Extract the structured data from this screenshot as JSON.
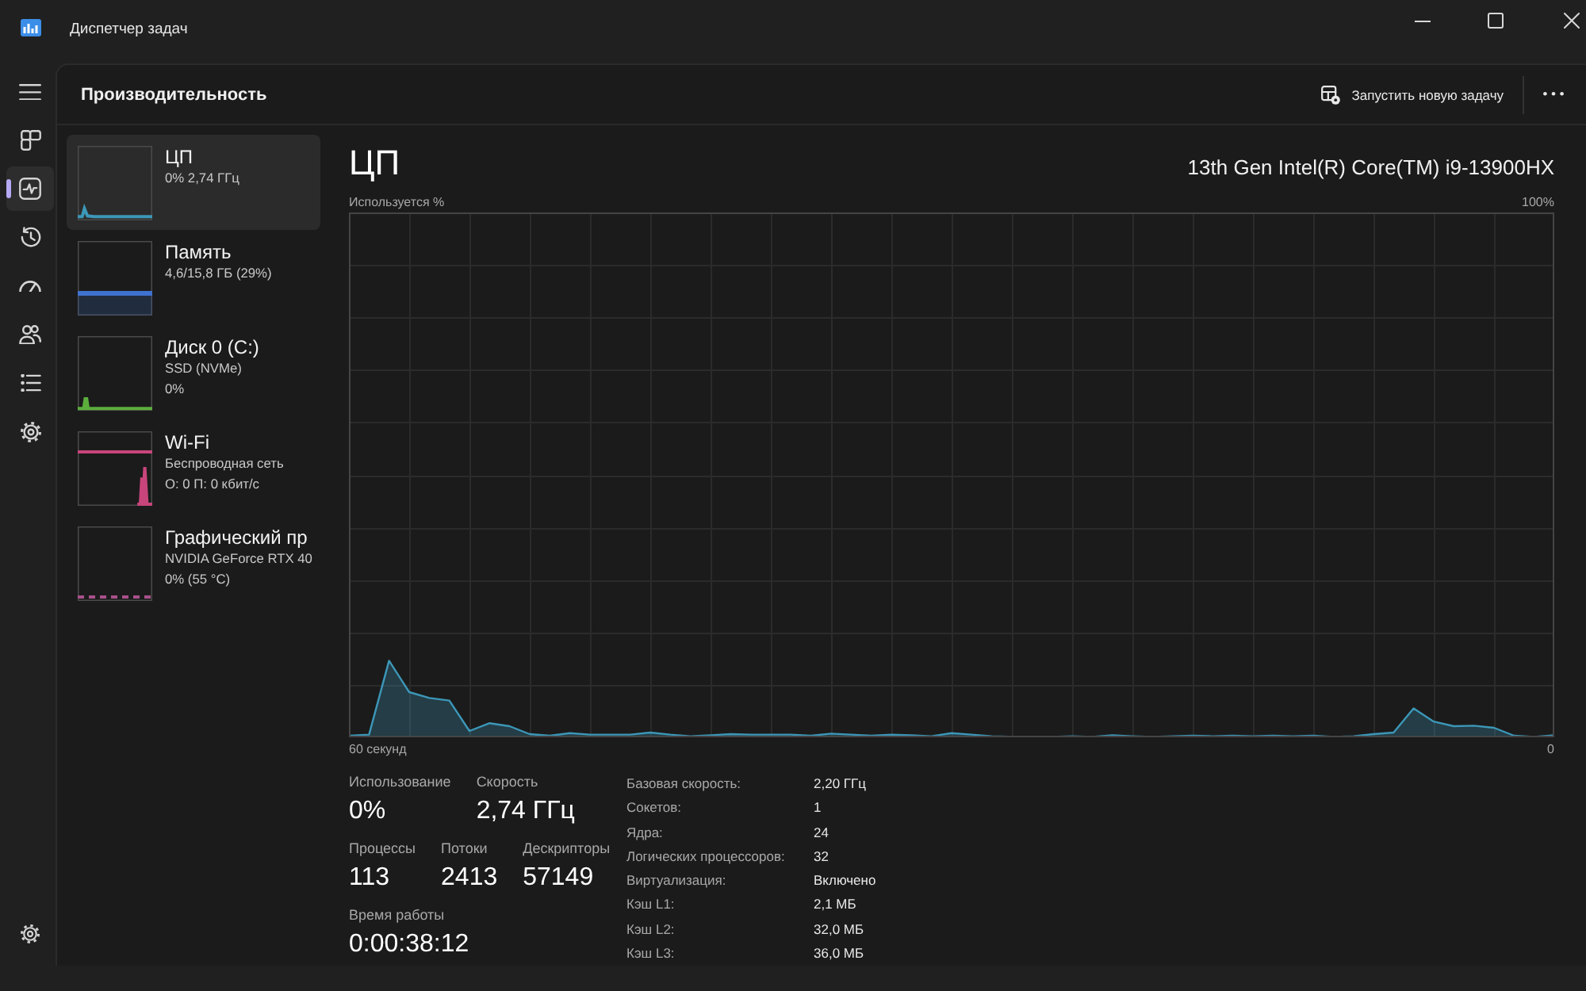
{
  "window": {
    "title": "Диспетчер задач"
  },
  "nav": {
    "items": [
      {
        "kind": "processes",
        "selected": false
      },
      {
        "kind": "performance",
        "selected": true
      },
      {
        "kind": "app_history",
        "selected": false
      },
      {
        "kind": "startup",
        "selected": false
      },
      {
        "kind": "users",
        "selected": false
      },
      {
        "kind": "details",
        "selected": false
      },
      {
        "kind": "services",
        "selected": false
      }
    ],
    "footer_items": [
      {
        "kind": "settings",
        "selected": false
      }
    ]
  },
  "header": {
    "title": "Производительность",
    "actions": [
      {
        "kind": "run_task",
        "label": "Запустить новую задачу"
      },
      {
        "kind": "more"
      }
    ]
  },
  "devices": [
    {
      "kind": "cpu",
      "name": "ЦП",
      "details": [
        "0% 2,74 ГГц"
      ],
      "color": "#3c97b8",
      "selected": true
    },
    {
      "kind": "memory",
      "name": "Память",
      "details": [
        "4,6/15,8 ГБ (29%)"
      ],
      "color": "#3f72d0",
      "selected": false
    },
    {
      "kind": "disk",
      "name": "Диск 0 (C:)",
      "details": [
        "SSD (NVMe)",
        "0%"
      ],
      "color": "#5cae3c",
      "selected": false
    },
    {
      "kind": "network",
      "name": "Wi-Fi",
      "details": [
        "Беспроводная сеть",
        "О: 0 П: 0 кбит/с"
      ],
      "color": "#c8457c",
      "selected": false
    },
    {
      "kind": "gpu",
      "name": "Графический пр",
      "details": [
        "NVIDIA GeForce RTX 40",
        "0% (55 °C)"
      ],
      "color": "#a8508a",
      "selected": false
    }
  ],
  "detail": {
    "title": "ЦП",
    "model": "13th Gen Intel(R) Core(TM) i9-13900HX",
    "graph": {
      "y_label": "Используется %",
      "y_max_label": "100%",
      "x_start_label": "60 секунд",
      "x_end_label": "0"
    },
    "stats": [
      {
        "items": [
          {
            "label": "Использование",
            "value": "0%"
          },
          {
            "label": "Скорость",
            "value": "2,74 ГГц"
          }
        ]
      },
      {
        "items": [
          {
            "label": "Процессы",
            "value": "113"
          },
          {
            "label": "Потоки",
            "value": "2413"
          },
          {
            "label": "Дескрипторы",
            "value": "57149"
          }
        ]
      },
      {
        "items": [
          {
            "label": "Время работы",
            "value": "0:00:38:12"
          }
        ]
      }
    ],
    "specs": [
      {
        "label": "Базовая скорость:",
        "value": "2,20 ГГц"
      },
      {
        "label": "Сокетов:",
        "value": "1"
      },
      {
        "label": "Ядра:",
        "value": "24"
      },
      {
        "label": "Логических процессоров:",
        "value": "32"
      },
      {
        "label": "Виртуализация:",
        "value": "Включено"
      },
      {
        "label": "Кэш L1:",
        "value": "2,1 МБ"
      },
      {
        "label": "Кэш L2:",
        "value": "32,0 МБ"
      },
      {
        "label": "Кэш L3:",
        "value": "36,0 МБ"
      }
    ]
  }
}
